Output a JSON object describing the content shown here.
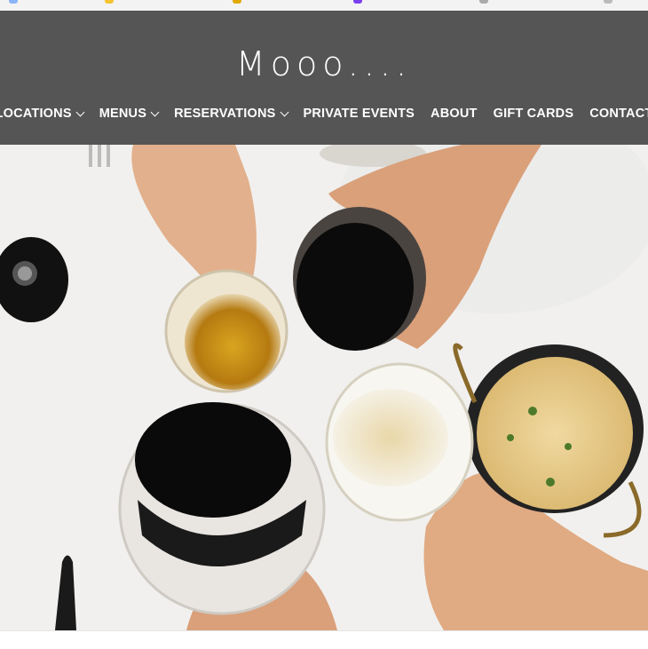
{
  "site": {
    "logo_text": "Mooo...."
  },
  "nav": {
    "items": [
      {
        "label": "LOCATIONS",
        "has_dropdown": true
      },
      {
        "label": "MENUS",
        "has_dropdown": true
      },
      {
        "label": "RESERVATIONS",
        "has_dropdown": true
      },
      {
        "label": "PRIVATE EVENTS",
        "has_dropdown": false
      },
      {
        "label": "ABOUT",
        "has_dropdown": false
      },
      {
        "label": "GIFT CARDS",
        "has_dropdown": false
      },
      {
        "label": "CONTACT",
        "has_dropdown": false
      }
    ]
  },
  "colors": {
    "header_bg": "#555555",
    "nav_text": "#ffffff"
  },
  "hero": {
    "image_icon": "toast-wine-glasses-image"
  }
}
